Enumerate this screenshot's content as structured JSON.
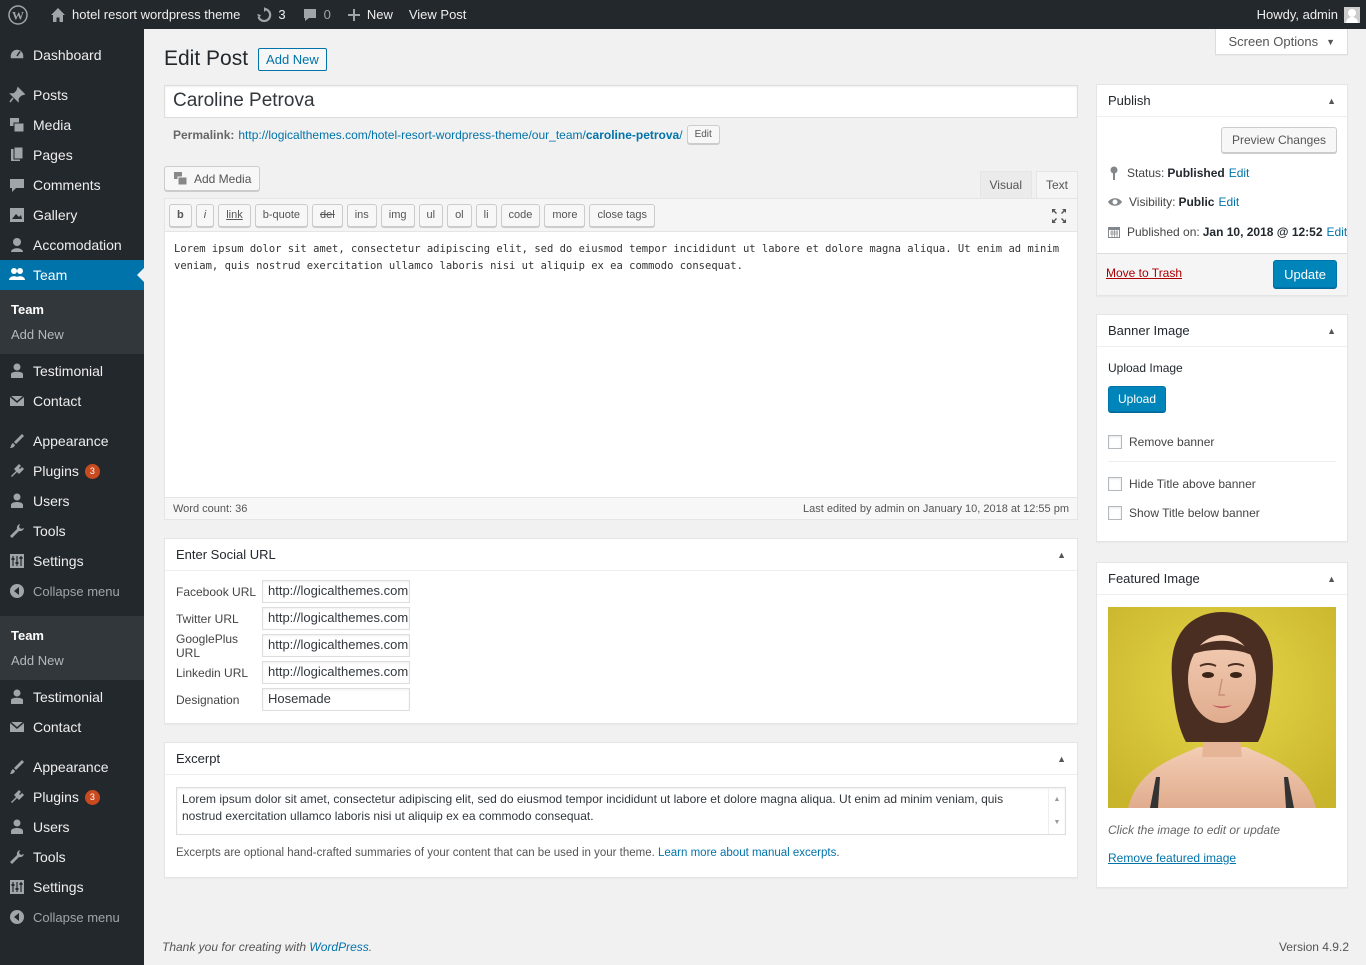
{
  "adminbar": {
    "site_name": "hotel resort wordpress theme",
    "updates_count": "3",
    "comments_count": "0",
    "new_label": "New",
    "view_post_label": "View Post",
    "howdy": "Howdy, admin"
  },
  "sidebar": {
    "items_top": [
      {
        "label": "Dashboard",
        "icon": "dashboard-icon"
      },
      {
        "label": "Posts",
        "icon": "pin-icon"
      },
      {
        "label": "Media",
        "icon": "media-icon"
      },
      {
        "label": "Pages",
        "icon": "page-icon"
      },
      {
        "label": "Comments",
        "icon": "comment-icon"
      },
      {
        "label": "Gallery",
        "icon": "gallery-icon"
      },
      {
        "label": "Accomodation",
        "icon": "accommodation-icon"
      },
      {
        "label": "Team",
        "icon": "team-icon"
      }
    ],
    "team_sub": [
      "Team",
      "Add New"
    ],
    "items_mid": [
      {
        "label": "Testimonial",
        "icon": "testimonial-icon"
      },
      {
        "label": "Contact",
        "icon": "contact-icon"
      },
      {
        "label": "Appearance",
        "icon": "appearance-icon"
      },
      {
        "label": "Plugins",
        "icon": "plugin-icon",
        "badge": "3"
      },
      {
        "label": "Users",
        "icon": "users-icon"
      },
      {
        "label": "Tools",
        "icon": "tools-icon"
      },
      {
        "label": "Settings",
        "icon": "settings-icon"
      },
      {
        "label": "Collapse menu",
        "icon": "collapse-icon"
      }
    ],
    "team_sub2": [
      "Team",
      "Add New"
    ],
    "items_bottom": [
      {
        "label": "Testimonial",
        "icon": "testimonial-icon"
      },
      {
        "label": "Contact",
        "icon": "contact-icon"
      },
      {
        "label": "Appearance",
        "icon": "appearance-icon"
      },
      {
        "label": "Plugins",
        "icon": "plugin-icon",
        "badge": "3"
      },
      {
        "label": "Users",
        "icon": "users-icon"
      },
      {
        "label": "Tools",
        "icon": "tools-icon"
      },
      {
        "label": "Settings",
        "icon": "settings-icon"
      },
      {
        "label": "Collapse menu",
        "icon": "collapse-icon"
      }
    ]
  },
  "header": {
    "screen_options": "Screen Options",
    "title": "Edit Post",
    "add_new": "Add New"
  },
  "post": {
    "title": "Caroline Petrova",
    "permalink_label": "Permalink:",
    "permalink_base": "http://logicalthemes.com/hotel-resort-wordpress-theme/our_team/",
    "permalink_slug": "caroline-petrova",
    "permalink_end": "/",
    "permalink_edit": "Edit"
  },
  "editor": {
    "add_media": "Add Media",
    "tab_visual": "Visual",
    "tab_text": "Text",
    "buttons": [
      "b",
      "i",
      "link",
      "b-quote",
      "del",
      "ins",
      "img",
      "ul",
      "ol",
      "li",
      "code",
      "more",
      "close tags"
    ],
    "content": "Lorem ipsum dolor sit amet, consectetur adipiscing elit, sed do eiusmod tempor incididunt ut labore et dolore magna aliqua. Ut enim ad minim veniam, quis nostrud exercitation ullamco laboris nisi ut aliquip ex ea commodo consequat.",
    "word_count": "Word count: 36",
    "last_edited": "Last edited by admin on January 10, 2018 at 12:55 pm"
  },
  "social": {
    "title": "Enter Social URL",
    "fields": [
      {
        "label": "Facebook URL",
        "value": "http://logicalthemes.com"
      },
      {
        "label": "Twitter URL",
        "value": "http://logicalthemes.com"
      },
      {
        "label": "GooglePlus URL",
        "value": "http://logicalthemes.com"
      },
      {
        "label": "Linkedin URL",
        "value": "http://logicalthemes.com"
      },
      {
        "label": "Designation",
        "value": "Hosemade"
      }
    ]
  },
  "excerpt": {
    "title": "Excerpt",
    "content": "Lorem ipsum dolor sit amet, consectetur adipiscing elit, sed do eiusmod tempor incididunt ut labore et dolore magna aliqua. Ut enim ad minim veniam, quis nostrud exercitation ullamco laboris nisi ut aliquip ex ea commodo consequat.",
    "note": "Excerpts are optional hand-crafted summaries of your content that can be used in your theme.",
    "note_link": "Learn more about manual excerpts",
    "note_end": "."
  },
  "publish": {
    "title": "Publish",
    "preview": "Preview Changes",
    "status_label": "Status:",
    "status_value": "Published",
    "visibility_label": "Visibility:",
    "visibility_value": "Public",
    "published_label": "Published on:",
    "published_value": "Jan 10, 2018 @ 12:52",
    "edit": "Edit",
    "trash": "Move to Trash",
    "update": "Update"
  },
  "banner": {
    "title": "Banner Image",
    "upload_label": "Upload Image",
    "upload_btn": "Upload",
    "remove": "Remove banner",
    "hide_title": "Hide Title above banner",
    "show_title": "Show Title below banner"
  },
  "featured": {
    "title": "Featured Image",
    "hint": "Click the image to edit or update",
    "remove": "Remove featured image"
  },
  "footer": {
    "thanks": "Thank you for creating with",
    "wp_link": "WordPress",
    "thanks_end": ".",
    "version": "Version 4.9.2"
  },
  "colors": {
    "adminbar_bg": "#23282d",
    "accent": "#0073aa",
    "primary_button": "#0085ba",
    "badge": "#ca4a1f",
    "featured_bg": "#d8c53a"
  }
}
